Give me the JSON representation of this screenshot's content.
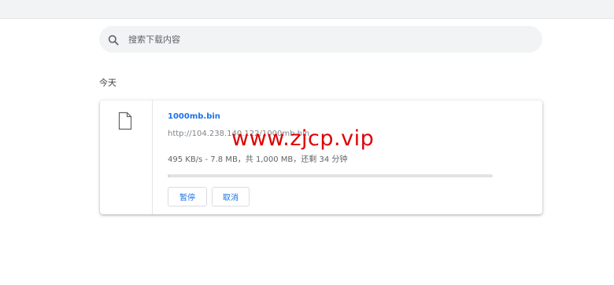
{
  "search": {
    "placeholder": "搜索下载内容",
    "icon": "search-icon"
  },
  "section": {
    "title": "今天"
  },
  "download": {
    "filename": "1000mb.bin",
    "url": "http://104.238.140.122/1000mb.bin",
    "status": "495 KB/s - 7.8 MB，共 1,000 MB，还剩 34 分钟",
    "progress_fraction": 0.0078,
    "icon": "file-icon",
    "pause_label": "暂停",
    "cancel_label": "取消"
  },
  "watermark": {
    "text": "www.zjcp.vip"
  },
  "colors": {
    "accent": "#1a73e8",
    "watermark": "#e00000"
  }
}
